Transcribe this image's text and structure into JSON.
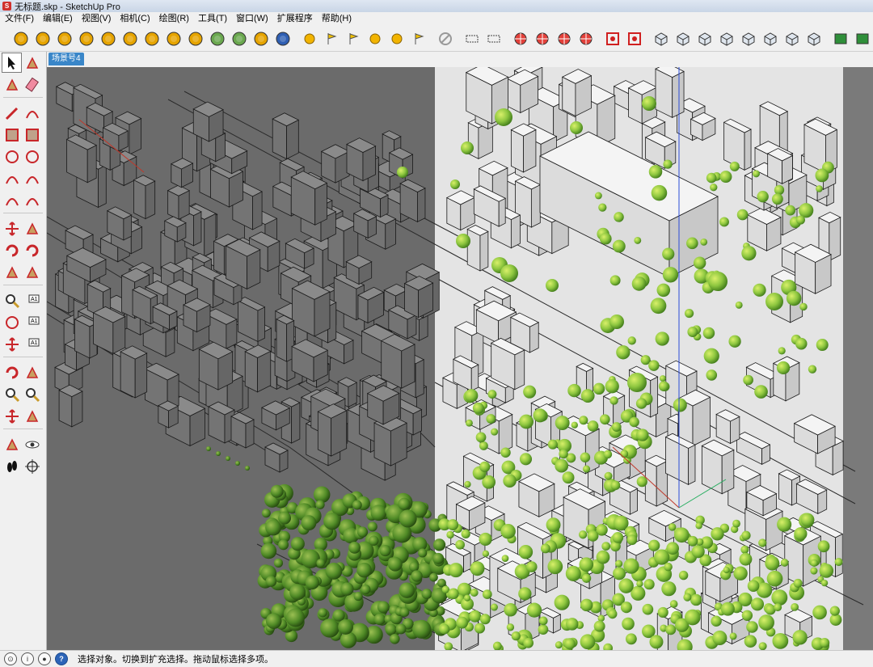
{
  "window": {
    "title": "无标题.skp - SketchUp Pro"
  },
  "menubar": {
    "items": [
      "文件(F)",
      "编辑(E)",
      "视图(V)",
      "相机(C)",
      "绘图(R)",
      "工具(T)",
      "窗口(W)",
      "扩展程序",
      "帮助(H)"
    ]
  },
  "scene_tabs": {
    "active_label": "场景号4"
  },
  "toolbar": {
    "groups": [
      [
        "m-plugin-icon",
        "tag-plugin-icon",
        "r-plugin-icon",
        "rt-plugin-icon",
        "br-plugin-icon",
        "help-plugin-icon",
        "tag2-plugin-icon",
        "sphere-plugin-icon",
        "fence-plugin-icon",
        "tree-plugin-icon",
        "tree2-plugin-icon",
        "target-plugin-icon",
        "chart-plugin-icon"
      ],
      [
        "light-bulb-icon",
        "lamp-icon",
        "flag-icon",
        "half-sphere-icon",
        "dot-sphere-icon",
        "flag2-icon"
      ],
      [
        "no-entry-icon"
      ],
      [
        "section-icon",
        "dotted-section-icon"
      ],
      [
        "star-burst-icon",
        "color-wheel-icon",
        "cross-grid-icon",
        "list-icon"
      ],
      [
        "gear-red-icon",
        "panel-red-icon"
      ],
      [
        "iso-view-icon",
        "top-view-icon",
        "front-view-icon",
        "right-view-icon",
        "back-view-icon",
        "left-view-icon",
        "shaded-icon",
        "texture-icon"
      ],
      [
        "shadow-icon",
        "fog-icon"
      ]
    ]
  },
  "left_toolbar": {
    "rows": [
      [
        "select-arrow-icon",
        "component-icon"
      ],
      [
        "paint-bucket-icon",
        "eraser-icon"
      ],
      [
        "pencil-line-icon",
        "freehand-icon"
      ],
      [
        "rectangle-icon",
        "rotated-rectangle-icon"
      ],
      [
        "circle-icon",
        "polygon-icon"
      ],
      [
        "arc-icon",
        "two-point-arc-icon"
      ],
      [
        "three-point-arc-icon",
        "pie-icon"
      ],
      [
        "move-icon",
        "push-pull-icon"
      ],
      [
        "rotate-icon",
        "follow-me-icon"
      ],
      [
        "scale-icon",
        "offset-icon"
      ],
      [
        "tape-measure-icon",
        "dimension-icon"
      ],
      [
        "protractor-icon",
        "text-label-icon"
      ],
      [
        "axes-icon",
        "3d-text-icon"
      ],
      [
        "orbit-icon",
        "pan-icon"
      ],
      [
        "zoom-icon",
        "zoom-window-icon"
      ],
      [
        "zoom-extents-icon",
        "previous-view-icon"
      ],
      [
        "position-camera-icon",
        "look-around-icon"
      ],
      [
        "walk-icon",
        "section-plane-icon"
      ]
    ]
  },
  "statusbar": {
    "icons": [
      "geo-icon",
      "info-icon",
      "user-icon",
      "help-icon"
    ],
    "message": "选择对象。切换到扩充选择。拖动鼠标选择多项。"
  },
  "colors": {
    "viewport_dark": "#6b6b6b",
    "viewport_light": "#e6e6e6",
    "foliage": "#8dc63f",
    "foliage_dark": "#3f7a1a",
    "axis_red": "#c0392b",
    "axis_green": "#27ae60",
    "axis_blue": "#2a4bd7"
  }
}
